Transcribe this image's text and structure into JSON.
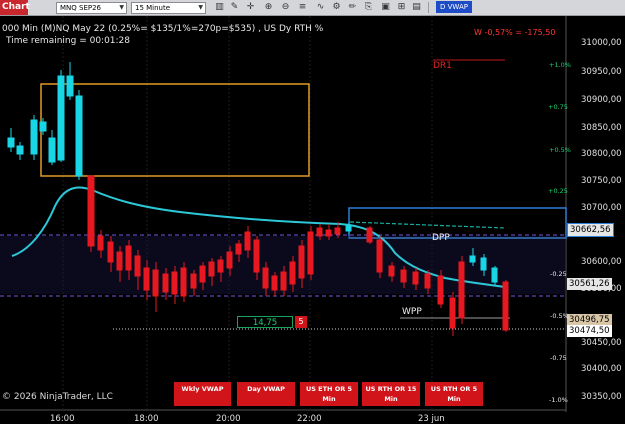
{
  "toolbar": {
    "tab_label": "Chart",
    "instrument": "MNQ SEP26",
    "interval": "15 Minute",
    "vwap_button": "D VWAP"
  },
  "info": {
    "line1": "000 Min (M)NQ May 22 (0.25%= $135/1%=270p=$535) , US Dy RTH %",
    "line2": "Time remaining = 00:01:28"
  },
  "pnl_label": "W -0,57% = -175,50",
  "dr1_label": "DR1",
  "levels": {
    "dpp": "DPP",
    "wpp": "WPP"
  },
  "order_size": {
    "quantity": "14,75",
    "count": "5"
  },
  "price_axis": {
    "labels": [
      "31000,00",
      "30950,00",
      "30900,00",
      "30850,00",
      "30800,00",
      "30750,00",
      "30700,00",
      "30600,00",
      "30550,00",
      "30450,00",
      "30400,00",
      "30350,00"
    ],
    "badges": [
      "30662,56",
      "30561,26",
      "30496,75",
      "30474,50"
    ],
    "pct_labels": [
      "+1.0%",
      "+0.75",
      "+0.5%",
      "+0.25",
      "-0.25",
      "-0.5%",
      "-0.75",
      "-1.0%"
    ]
  },
  "time_axis": [
    "16:00",
    "18:00",
    "20:00",
    "22:00",
    "23 jun"
  ],
  "bottom_buttons": [
    {
      "line1": "Wkly VWAP",
      "line2": ""
    },
    {
      "line1": "Day VWAP",
      "line2": ""
    },
    {
      "line1": "US ETH OR 5",
      "line2": "Min"
    },
    {
      "line1": "US RTH OR 15",
      "line2": "Min"
    },
    {
      "line1": "US RTH OR 5",
      "line2": "Min"
    }
  ],
  "copyright": "© 2026 NinjaTrader, LLC",
  "colors": {
    "up": "#19d6e6",
    "down": "#e81820",
    "accent_red": "#d0141a",
    "vwap_blue": "#1e4cc7"
  }
}
